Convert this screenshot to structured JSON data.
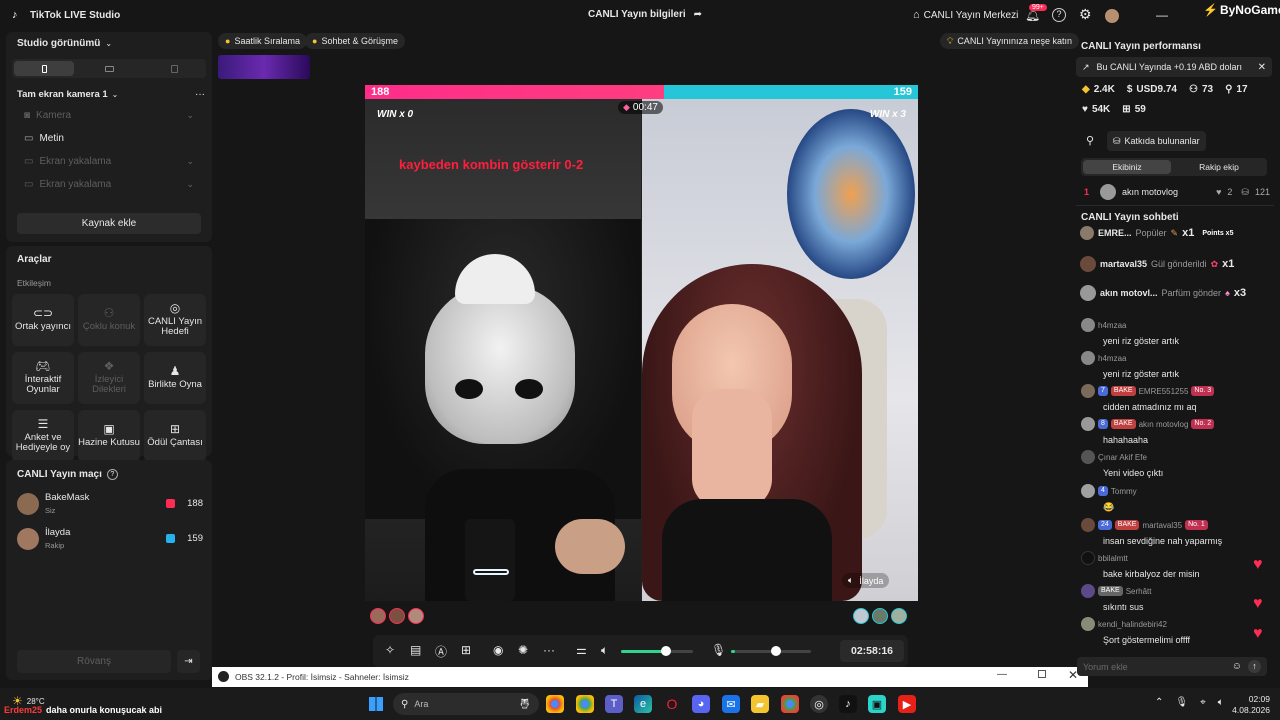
{
  "app": {
    "title": "TikTok LIVE Studio",
    "center_title": "CANLI Yayın bilgileri",
    "live_center": "CANLI Yayın Merkezi",
    "notif_count": "99+",
    "watermark": "ByNoGame"
  },
  "left": {
    "view_label": "Studio görünümü",
    "scene_name": "Tam ekran kamera 1",
    "sources": [
      "Kamera",
      "Metin",
      "Ekran yakalama",
      "Ekran yakalama"
    ],
    "add_source": "Kaynak ekle",
    "tools_title": "Araçlar",
    "tools_sub": "Etkileşim",
    "tools": [
      "Ortak yayıncı",
      "Çoklu konuk",
      "CANLI Yayın Hedefi",
      "İnteraktif Oyunlar",
      "İzleyici Dilekleri",
      "Birlikte Oyna",
      "Anket ve Hediyeyle oy",
      "Hazine Kutusu",
      "Ödül Çantası"
    ],
    "match_title": "CANLI Yayın maçı",
    "match": [
      {
        "name": "BakeMask",
        "role": "Siz",
        "score": "188"
      },
      {
        "name": "İlayda",
        "role": "Rakip",
        "score": "159"
      }
    ],
    "rematch": "Rövanş"
  },
  "top_chips": {
    "left1": "Saatlik Sıralama",
    "left2": "Sohbet & Görüşme",
    "right": "CANLI Yayınınıza neşe katın"
  },
  "battle": {
    "left_score": "188",
    "right_score": "159",
    "timer": "00:47",
    "left_win": "WIN x 0",
    "right_win": "WIN x 3",
    "overlay_text": "kaybeden kombin gösterir 0-2",
    "right_name": "İlayda",
    "left_pct": 0.54
  },
  "controls": {
    "duration": "02:58:16"
  },
  "obs": {
    "title": "OBS 32.1.2 - Profil: İsimsiz - Sahneler: İsimsiz"
  },
  "right": {
    "perf_title": "CANLI Yayın performansı",
    "earn_text": "Bu CANLI Yayında +0.19 ABD doları",
    "stats": {
      "diamonds": "2.4K",
      "usd": "USD9.74",
      "viewers": "73",
      "people": "17",
      "likes": "54K",
      "gifts": "59"
    },
    "contrib_btn": "Katkıda bulunanlar",
    "tabs": [
      "Ekibiniz",
      "Rakip ekip"
    ],
    "contributor": {
      "rank": "1",
      "name": "akın motovlog",
      "hearts": "2",
      "score": "121"
    },
    "chat_title": "CANLI Yayın sohbeti",
    "gifts": [
      {
        "user": "EMRE...",
        "label": "Popüler",
        "count": "x1",
        "extra": "Points x5"
      },
      {
        "user": "martaval35",
        "label": "Gül gönderildi",
        "count": "x1"
      },
      {
        "user": "akın motovl...",
        "label": "Parfüm gönder",
        "count": "x3"
      }
    ],
    "messages": [
      {
        "user": "h4mzaa",
        "text": "yeni riz göster artık"
      },
      {
        "user": "h4mzaa",
        "text": "yeni riz göster artık"
      },
      {
        "user": "EMRE551255",
        "lvl": "7",
        "team": "BAKE",
        "rank": "No. 3",
        "text": "cidden atmadınız mı aq"
      },
      {
        "user": "akın motovlog",
        "lvl": "8",
        "team": "BAKE",
        "rank": "No. 2",
        "text": "hahahaaha"
      },
      {
        "user": "Çınar Akif Efe",
        "text": "Yeni video çıktı"
      },
      {
        "user": "Tommy",
        "lvl": "4",
        "text": "😂"
      },
      {
        "user": "martaval35",
        "lvl": "24",
        "team": "BAKE",
        "rank": "No. 1",
        "text": "insan sevdiğine nah yaparmış"
      },
      {
        "user": "bbilalmtt",
        "text": "bake kirbalyoz der misin"
      },
      {
        "user": "Serhâtt",
        "team": "BAKE",
        "text": "sıkıntı sus"
      },
      {
        "user": "kendi_halindebiri42",
        "text": "Şort göstermelimi offff"
      }
    ],
    "comment_placeholder": "Yorum ekle"
  },
  "taskbar": {
    "weather": "28°C",
    "search": "Ara",
    "time": "02:09",
    "date": "4.08.2026",
    "ticker_user": "Erdem25",
    "ticker_text": "daha onurla konuşucak abi"
  }
}
